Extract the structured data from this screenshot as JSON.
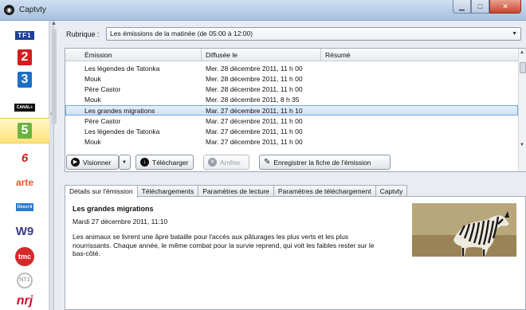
{
  "window": {
    "title": "Captvty"
  },
  "channels": [
    "TF1",
    "2",
    "3",
    "CANAL+",
    "5",
    "6",
    "arte",
    "Direct 8",
    "W9",
    "tmc",
    "NT1",
    "nrj"
  ],
  "rubrique": {
    "label": "Rubrique :",
    "value": "Les émissions de la matinée (de 05:00 à 12:00)"
  },
  "grid": {
    "columns": [
      "Émission",
      "Diffusée le",
      "Résumé"
    ],
    "rows": [
      {
        "emission": "Les légendes de Tatonka",
        "date": "Mer. 28 décembre 2011, 11 h 00"
      },
      {
        "emission": "Mouk",
        "date": "Mer. 28 décembre 2011, 11 h 00"
      },
      {
        "emission": "Père Castor",
        "date": "Mer. 28 décembre 2011, 11 h 00"
      },
      {
        "emission": "Mouk",
        "date": "Mer. 28 décembre 2011, 8 h 35"
      },
      {
        "emission": "Les grandes migrations",
        "date": "Mar. 27 décembre 2011, 11 h 10"
      },
      {
        "emission": "Père Castor",
        "date": "Mar. 27 décembre 2011, 11 h 00"
      },
      {
        "emission": "Les légendes de Tatonka",
        "date": "Mar. 27 décembre 2011, 11 h 00"
      },
      {
        "emission": "Mouk",
        "date": "Mar. 27 décembre 2011, 11 h 00"
      }
    ]
  },
  "toolbar": {
    "visionner": "Visionner",
    "telecharger": "Télécharger",
    "arreter": "Arrêter",
    "enregistrer": "Enregistrer la fiche de l'émission"
  },
  "tabs": [
    "Détails sur l'émission",
    "Téléchargements",
    "Paramètres de lecture",
    "Paramètres de téléchargement",
    "Captvty"
  ],
  "details": {
    "title": "Les grandes migrations",
    "date": "Mardi 27 décembre 2011, 11:10",
    "summary": "Les animaux se livrent une âpre bataille pour l'accès aux pâturages les plus verts et les plus nourrissants. Chaque année, le même combat pour la survie reprend, qui voit les faibles rester sur le bas-côté."
  }
}
